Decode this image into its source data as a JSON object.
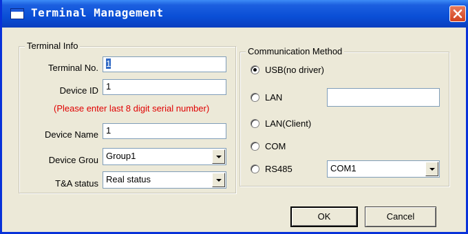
{
  "window": {
    "title": "Terminal Management"
  },
  "terminal_info": {
    "legend": "Terminal Info",
    "terminal_no": {
      "label": "Terminal No.",
      "value": "1"
    },
    "device_id": {
      "label": "Device ID",
      "value": "1"
    },
    "hint": "(Please enter last 8 digit serial number)",
    "device_name": {
      "label": "Device Name",
      "value": "1"
    },
    "device_group": {
      "label": "Device Grou",
      "value": "Group1"
    },
    "ta_status": {
      "label": "T&A status",
      "value": "Real status"
    }
  },
  "communication": {
    "legend": "Communication Method",
    "options": [
      {
        "label": "USB(no driver)",
        "selected": true
      },
      {
        "label": "LAN",
        "selected": false
      },
      {
        "label": "LAN(Client)",
        "selected": false
      },
      {
        "label": "COM",
        "selected": false
      },
      {
        "label": "RS485",
        "selected": false
      }
    ],
    "lan_address": "",
    "rs485_port": "COM1"
  },
  "buttons": {
    "ok": "OK",
    "cancel": "Cancel"
  },
  "colors": {
    "titlebar": "#0a4fd6",
    "hint": "#e00000",
    "close": "#d2431f"
  }
}
